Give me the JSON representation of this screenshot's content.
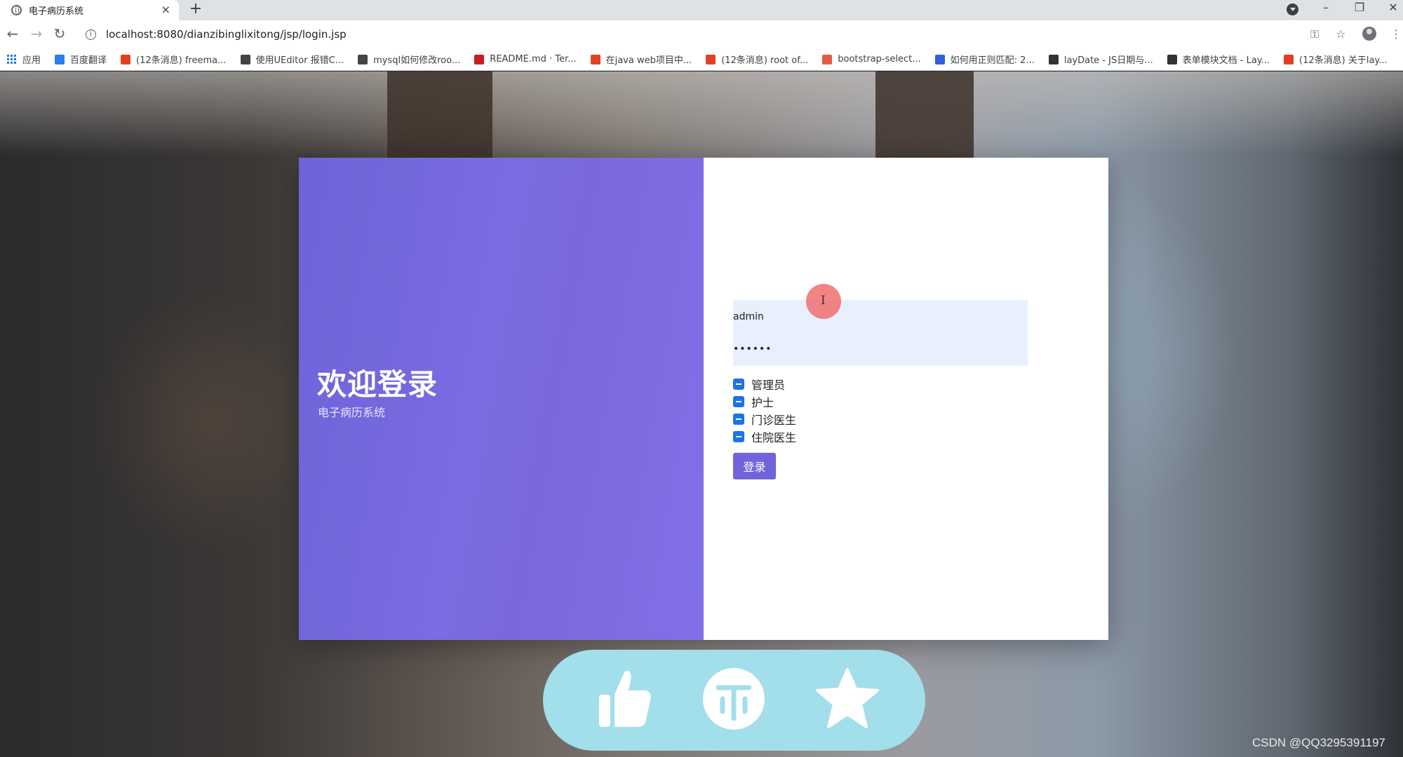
{
  "browser": {
    "tab_title": "电子病历系统",
    "tab_close": "×",
    "new_tab": "+",
    "url": "localhost:8080/dianzibinglixitong/jsp/login.jsp",
    "window_controls": {
      "minimize": "–",
      "restore": "❐",
      "close": "✕"
    },
    "bookmarks": [
      {
        "label": "应用",
        "icon": "apps-icon",
        "color": "#1a73e8"
      },
      {
        "label": "百度翻译",
        "icon": "translate-icon",
        "color": "#2b7de9"
      },
      {
        "label": "(12条消息) freema...",
        "icon": "csdn-icon",
        "color": "#e1411f"
      },
      {
        "label": "使用UEditor 报错C...",
        "icon": "chatgpt-icon",
        "color": "#444444"
      },
      {
        "label": "mysql如何修改roo...",
        "icon": "chatgpt-icon",
        "color": "#444444"
      },
      {
        "label": "README.md · Ter...",
        "icon": "gitee-icon",
        "color": "#c71d23"
      },
      {
        "label": "在java web项目中...",
        "icon": "csdn-icon",
        "color": "#e1411f"
      },
      {
        "label": "(12条消息) root of...",
        "icon": "csdn-icon",
        "color": "#e1411f"
      },
      {
        "label": "bootstrap-select...",
        "icon": "doc-icon",
        "color": "#e25c45"
      },
      {
        "label": "如何用正则匹配: 2...",
        "icon": "baidu-icon",
        "color": "#3060e0"
      },
      {
        "label": "layDate - JS日期与...",
        "icon": "layui-icon",
        "color": "#333333"
      },
      {
        "label": "表单模块文档 - Lay...",
        "icon": "layui-icon",
        "color": "#333333"
      },
      {
        "label": "(12条消息) 关于lay...",
        "icon": "csdn-icon",
        "color": "#e1411f"
      }
    ]
  },
  "login": {
    "title": "欢迎登录",
    "subtitle": "电子病历系统",
    "username": "admin",
    "password": "••••••",
    "roles": [
      "管理员",
      "护士",
      "门诊医生",
      "住院医生"
    ],
    "submit": "登录"
  },
  "colors": {
    "accent": "#7163dc",
    "checkbox": "#1a73e8",
    "input_bg": "#e8f0fe",
    "action_pill": "#a3deeb"
  },
  "actions": [
    {
      "name": "like",
      "icon": "thumbs-up-icon"
    },
    {
      "name": "coin",
      "icon": "coin-icon"
    },
    {
      "name": "favorite",
      "icon": "star-icon"
    }
  ],
  "watermark": "CSDN @QQ3295391197"
}
